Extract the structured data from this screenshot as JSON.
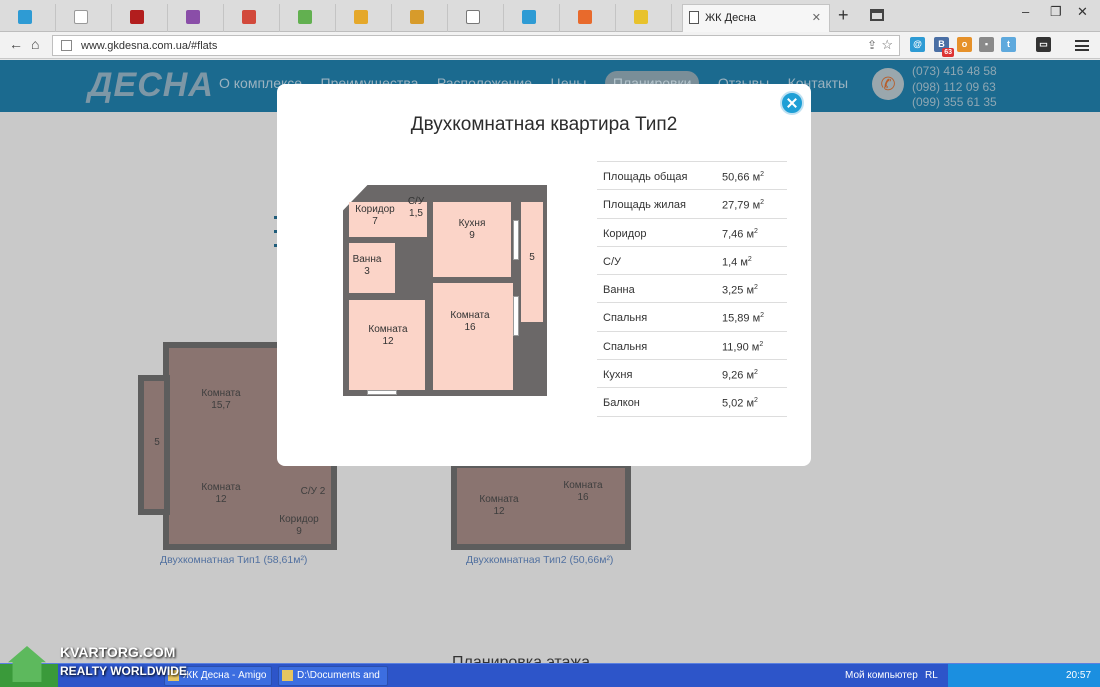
{
  "browser": {
    "tabs": [
      {
        "icon": "tab-favicon-circle"
      },
      {
        "icon": "tab-favicon-olx"
      },
      {
        "icon": "tab-favicon-100"
      },
      {
        "icon": "tab-favicon-r"
      },
      {
        "icon": "tab-favicon-house"
      },
      {
        "icon": "tab-favicon-money"
      },
      {
        "icon": "tab-favicon-d"
      },
      {
        "icon": "tab-favicon-r2"
      },
      {
        "icon": "tab-favicon-doc"
      },
      {
        "icon": "tab-favicon-home"
      },
      {
        "icon": "tab-favicon-orange"
      },
      {
        "icon": "tab-favicon-key"
      },
      {
        "icon": "tab-favicon-pin"
      },
      {
        "icon": "tab-favicon-exclaim"
      }
    ],
    "active_tab_title": "ЖК Десна",
    "url": "www.gkdesna.com.ua/#flats",
    "extension_badge": "63"
  },
  "site": {
    "logo": "ДЕСНА",
    "menu": [
      "О комплексе",
      "Преимущества",
      "Расположение",
      "Цены",
      "Планировки",
      "Отзывы",
      "Контакты"
    ],
    "active_menu": "Планировки",
    "phones": [
      "(073) 416 48 58",
      "(098) 112 09 63",
      "(099) 355 61 35"
    ],
    "plans": [
      {
        "caption": "Двухкомнатная Тип1 (58,61м²)",
        "rooms": [
          {
            "name": "Комната",
            "area": "15,7"
          },
          {
            "name": "5",
            "area": ""
          },
          {
            "name": "Комната",
            "area": "12"
          },
          {
            "name": "С/У",
            "area": "2"
          },
          {
            "name": "Коридор",
            "area": "9"
          }
        ]
      },
      {
        "caption": "Двухкомнатная Тип2 (50,66м²)",
        "rooms": [
          {
            "name": "Комната",
            "area": "12"
          },
          {
            "name": "Комната",
            "area": "16"
          }
        ]
      }
    ],
    "section_title": "Планировка этажа"
  },
  "modal": {
    "title": "Двухкомнатная квартира Тип2",
    "plan_rooms": [
      {
        "name": "Коридор",
        "area": "7"
      },
      {
        "name": "С/У",
        "area": "1,5"
      },
      {
        "name": "Кухня",
        "area": "9"
      },
      {
        "name": "5",
        "area": ""
      },
      {
        "name": "Ванна",
        "area": "3"
      },
      {
        "name": "Комната",
        "area": "12"
      },
      {
        "name": "Комната",
        "area": "16"
      }
    ],
    "specs": [
      {
        "label": "Площадь общая",
        "value": "50,66 м",
        "unit_sup": "2"
      },
      {
        "label": "Площадь жилая",
        "value": "27,79 м",
        "unit_sup": "2"
      },
      {
        "label": "Коридор",
        "value": "7,46 м",
        "unit_sup": "2"
      },
      {
        "label": "С/У",
        "value": "1,4 м",
        "unit_sup": "2"
      },
      {
        "label": "Ванна",
        "value": "3,25 м",
        "unit_sup": "2"
      },
      {
        "label": "Спальня",
        "value": "15,89 м",
        "unit_sup": "2"
      },
      {
        "label": "Спальня",
        "value": "11,90 м",
        "unit_sup": "2"
      },
      {
        "label": "Кухня",
        "value": "9,26 м",
        "unit_sup": "2"
      },
      {
        "label": "Балкон",
        "value": "5,02 м",
        "unit_sup": "2"
      }
    ]
  },
  "taskbar": {
    "tasks": [
      "ЖК Десна - Amigo",
      "D:\\Documents and Se..."
    ],
    "tray_label": "Мой компьютер",
    "lang": "RL",
    "clock": "20:57"
  },
  "watermark": {
    "line1": "KVARTORG.COM",
    "line2": "REALTY WORLDWIDE"
  },
  "colors": {
    "header": "#1b6a8f",
    "room_fill": "#fbd4c8",
    "wall": "#6b6868",
    "close_button": "#1e9fd6",
    "plan_caption": "#5271a0"
  }
}
